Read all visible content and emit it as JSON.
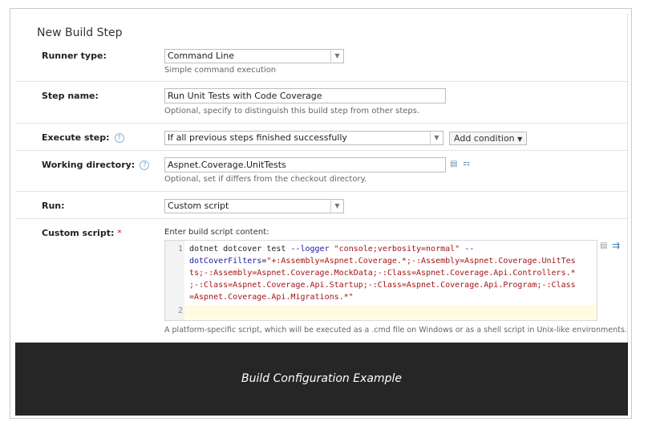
{
  "form": {
    "title": "New Build Step",
    "runner_type": {
      "label": "Runner type:",
      "value": "Command Line",
      "hint": "Simple command execution"
    },
    "step_name": {
      "label": "Step name:",
      "value": "Run Unit Tests with Code Coverage",
      "hint": "Optional, specify to distinguish this build step from other steps."
    },
    "execute_step": {
      "label": "Execute step:",
      "value": "If all previous steps finished successfully",
      "add_condition": "Add condition"
    },
    "working_directory": {
      "label": "Working directory:",
      "value": "Aspnet.Coverage.UnitTests",
      "hint": "Optional, set if differs from the checkout directory."
    },
    "run": {
      "label": "Run:",
      "value": "Custom script"
    },
    "custom_script": {
      "label": "Custom script:",
      "required_mark": "*",
      "content_label": "Enter build script content:",
      "line_numbers": [
        "1",
        "2"
      ],
      "lines": [
        [
          "dotnet dotcover test ",
          "--logger",
          " ",
          "\"console;verbosity=normal\"",
          " ",
          "--"
        ],
        [
          "",
          "dotCoverFilters",
          "=",
          "\"+:Assembly=Aspnet.Coverage.*;-:Assembly=Aspnet.Coverage.UnitTes",
          "",
          ""
        ],
        [
          "",
          "",
          "",
          "ts;-:Assembly=Aspnet.Coverage.MockData;-:Class=Aspnet.Coverage.Api.Controllers.*",
          "",
          ""
        ],
        [
          "",
          "",
          "",
          ";-:Class=Aspnet.Coverage.Api.Startup;-:Class=Aspnet.Coverage.Api.Program;-:Class",
          "",
          ""
        ],
        [
          "",
          "",
          "",
          "=Aspnet.Coverage.Api.Migrations.*\"",
          "",
          ""
        ]
      ],
      "hint": "A platform-specific script, which will be executed as a .cmd file on Windows or as a shell script in Unix-like environments."
    }
  },
  "caption": "Build Configuration Example",
  "icons": {
    "help": "help-icon",
    "dropdown": "chevron-down-icon",
    "browse": "browse-icon",
    "tree": "tree-icon",
    "wrap": "word-wrap-icon",
    "list": "list-icon"
  },
  "colors": {
    "caption_bg": "#262626",
    "keyword": "#1a1aa6",
    "string": "#a31515"
  }
}
